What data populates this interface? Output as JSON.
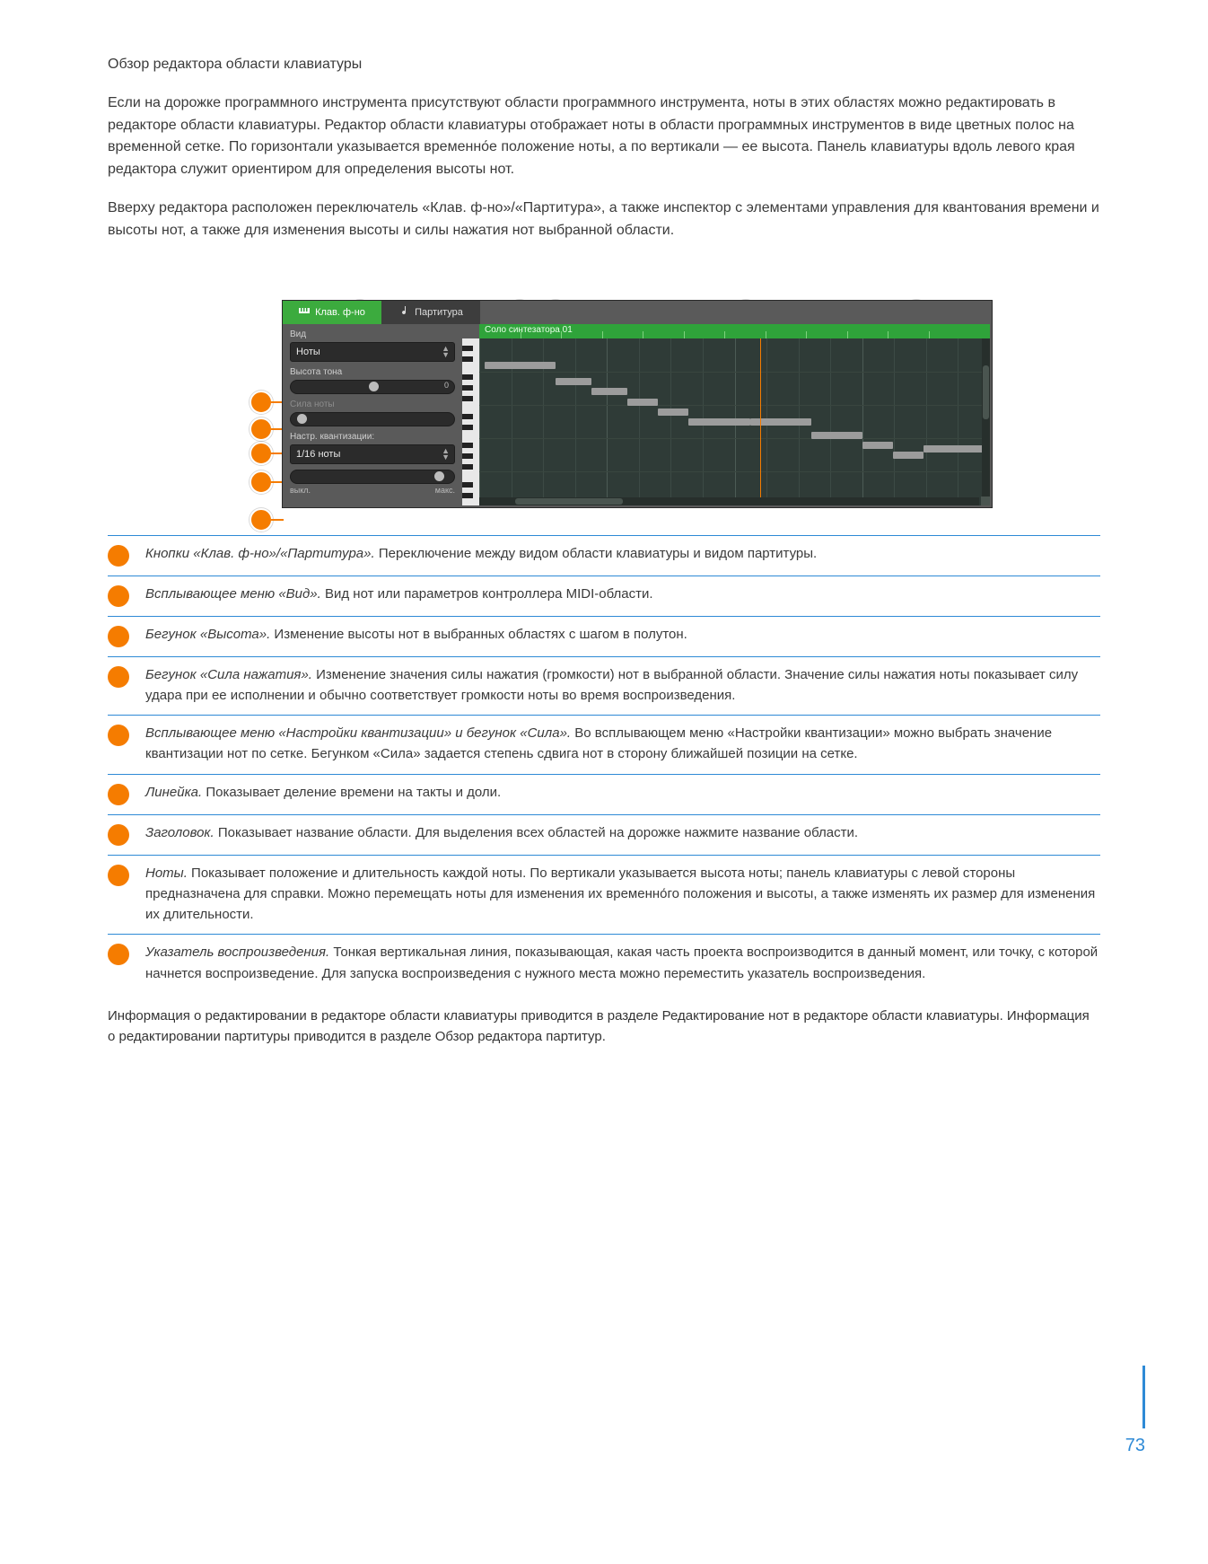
{
  "intro": {
    "p1": "Обзор редактора области клавиатуры",
    "p2": "Если на дорожке программного инструмента присутствуют области программного инструмента, ноты в этих областях можно редактировать в редакторе области клавиатуры. Редактор области клавиатуры отображает ноты в области программных инструментов в виде цветных полос на временной сетке. По горизонтали указывается временно́е положение ноты, а по вертикали — ее высота. Панель клавиатуры вдоль левого края редактора служит ориентиром для определения высоты нот.",
    "p3": "Вверху редактора расположен переключатель «Клав. ф-но»/«Партитура», а также инспектор с элементами управления для квантования времени и высоты нот, а также для изменения высоты и силы нажатия нот выбранной области."
  },
  "editor": {
    "tab_piano": "Клав. ф-но",
    "tab_score": "Партитура",
    "region_name": "Соло синтезатора 01",
    "panel": {
      "view_label": "Вид",
      "view_value": "Ноты",
      "pitch_label": "Высота тона",
      "pitch_max": "0",
      "velocity_label": "Сила ноты",
      "quant_label": "Настр. квантизации:",
      "quant_value": "1/16 ноты",
      "off_label": "выкл.",
      "max_label": "макс."
    }
  },
  "callouts": [
    {
      "term": "Кнопки «Клав. ф-но»/«Партитура».",
      "desc": " Переключение между видом области клавиатуры и видом партитуры."
    },
    {
      "term": "Всплывающее меню «Вид».",
      "desc": " Вид нот или параметров контроллера MIDI-области."
    },
    {
      "term": "Бегунок «Высота».",
      "desc": " Изменение высоты нот в выбранных областях с шагом в полутон."
    },
    {
      "term": "Бегунок «Сила нажатия».",
      "desc": " Изменение значения силы нажатия (громкости) нот в выбранной области. Значение силы нажатия ноты показывает силу удара при ее исполнении и обычно соответствует громкости ноты во время воспроизведения."
    },
    {
      "term": "Всплывающее меню «Настройки квантизации» и бегунок «Сила».",
      "desc": " Во всплывающем меню «Настройки квантизации» можно выбрать значение квантизации нот по сетке. Бегунком «Сила» задается степень сдвига нот в сторону ближайшей позиции на сетке."
    },
    {
      "term": "Линейка.",
      "desc": " Показывает деление времени на такты и доли."
    },
    {
      "term": "Заголовок.",
      "desc": " Показывает название области. Для выделения всех областей на дорожке нажмите название области."
    },
    {
      "term": "Ноты.",
      "desc": " Показывает положение и длительность каждой ноты. По вертикали указывается высота ноты; панель клавиатуры с левой стороны предназначена для справки. Можно перемещать ноты для изменения их временно́го положения и высоты, а также изменять их размер для изменения их длительности."
    },
    {
      "term": "Указатель воспроизведения.",
      "desc": " Тонкая вертикальная линия, показывающая, какая часть проекта воспроизводится в данный момент, или точку, с которой начнется воспроизведение. Для запуска воспроизведения с нужного места можно переместить указатель воспроизведения."
    }
  ],
  "links": {
    "before": "Информация о редактировании в редакторе области клавиатуры приводится в разделе ",
    "link1": "Редактирование нот в редакторе области клавиатуры",
    "between": ". Информация о редактировании партитуры приводится в разделе ",
    "link2": "Обзор редактора партитур",
    "after": "."
  },
  "page_number": "73"
}
